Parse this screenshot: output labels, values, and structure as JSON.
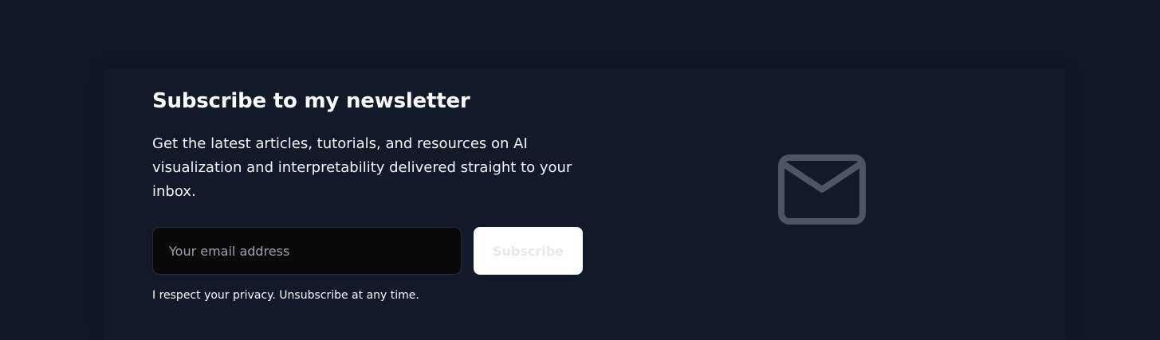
{
  "newsletter": {
    "title": "Subscribe to my newsletter",
    "description": "Get the latest articles, tutorials, and resources on AI visualization and interpretability delivered straight to your inbox.",
    "email_placeholder": "Your email address",
    "email_value": "",
    "subscribe_label": "Subscribe",
    "privacy_note": "I respect your privacy. Unsubscribe at any time."
  },
  "icons": {
    "envelope": "mail-icon"
  },
  "colors": {
    "background": "#111827",
    "card": "#121a2a",
    "input_background": "#0a0a0b",
    "button_background": "#ffffff",
    "icon": "#4b5563"
  }
}
